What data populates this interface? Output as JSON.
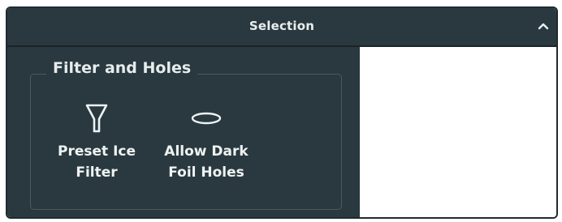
{
  "panel": {
    "title": "Selection",
    "collapse_icon": "chevron-up-icon"
  },
  "group": {
    "legend": "Filter and Holes",
    "tools": [
      {
        "icon": "funnel-icon",
        "label_line1": "Preset Ice",
        "label_line2": "Filter"
      },
      {
        "icon": "ellipse-icon",
        "label_line1": "Allow Dark",
        "label_line2": "Foil Holes"
      }
    ]
  },
  "colors": {
    "panel_bg": "#2a393f",
    "text": "#eef2f3",
    "border": "#4a5a60"
  }
}
